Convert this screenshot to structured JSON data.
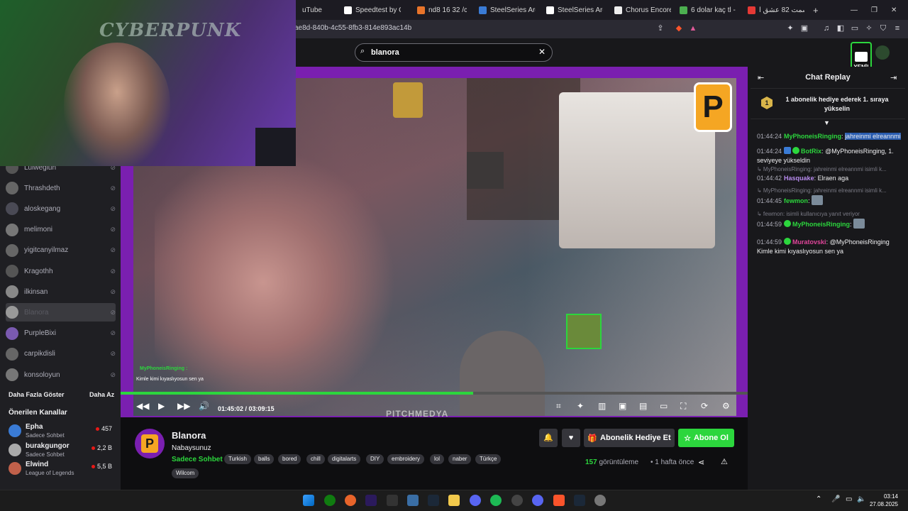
{
  "browser": {
    "tabs": [
      {
        "label": "uTube",
        "color": "#1c1b22"
      },
      {
        "label": "Speedtest by Ookla",
        "color": "#ffffff"
      },
      {
        "label": "nd8 16 32 /cpl fil",
        "color": "#e8742a"
      },
      {
        "label": "SteelSeries Arctis",
        "color": "#3a7bd5"
      },
      {
        "label": "SteelSeries Arctis",
        "color": "#ffffff"
      },
      {
        "label": "Chorus Encore",
        "color": "#eeeeee"
      },
      {
        "label": "6 dolar kaç tl - Go",
        "color": "#4caf50"
      },
      {
        "label": "قسمت 82 عشق ا",
        "color": "#e53935"
      }
    ],
    "new_tab": "+",
    "window_controls": [
      "—",
      "❐",
      "✕"
    ],
    "url": "ae8d-840b-4c55-8fb3-814e893ac14b"
  },
  "search": {
    "value": "blanora",
    "clear": "✕"
  },
  "header": {
    "new_badge": "YENİ!"
  },
  "webcam": {
    "overlay_text": "CYBERPUNK"
  },
  "sidebar": {
    "channels": [
      {
        "name": "Luiwegiun",
        "active": false
      },
      {
        "name": "Thrashdeth",
        "active": false
      },
      {
        "name": "aloskegang",
        "active": false
      },
      {
        "name": "melimoni",
        "active": false
      },
      {
        "name": "yigitcanyilmaz",
        "active": false
      },
      {
        "name": "Kragothh",
        "active": false
      },
      {
        "name": "ilkinsan",
        "active": false
      },
      {
        "name": "Blanora",
        "active": true
      },
      {
        "name": "PurpleBixi",
        "active": false
      },
      {
        "name": "carpikdisli",
        "active": false
      },
      {
        "name": "konsoloyun",
        "active": false
      }
    ],
    "more_label": "Daha Fazla Göster",
    "less_label": "Daha Az",
    "recommended_title": "Önerilen Kanallar",
    "recommended": [
      {
        "name": "Epha",
        "category": "Sadece Sohbet",
        "viewers": "457"
      },
      {
        "name": "burakgungor",
        "category": "Sadece Sohbet",
        "viewers": "2,2 B"
      },
      {
        "name": "Elwind",
        "category": "League of Legends",
        "viewers": "5,5 B"
      }
    ]
  },
  "player": {
    "logo": "P",
    "progress": 0.562,
    "current_time": "01:45:02",
    "duration": "03:09:15",
    "watermark": "PITCHMEDYA",
    "overlay_user": "MyPhoneisRinging :",
    "overlay_msg": "Kimle kimi kıyaslıyosun sen ya"
  },
  "channel": {
    "name": "Blanora",
    "title": "Nabaysunuz",
    "category": "Sadece Sohbet",
    "tags": [
      "Turkish",
      "balls",
      "bored",
      "chill",
      "digitalarts",
      "DIY",
      "embroidery",
      "lol",
      "naber",
      "Türkçe",
      "Wilcom"
    ],
    "gift_label": "Abonelik Hediye Et",
    "subscribe_label": "Abone Ol",
    "views_count": "157",
    "views_label": "görüntüleme",
    "ago": "1 hafta önce"
  },
  "chat": {
    "title": "Chat Replay",
    "banner_rank": "1",
    "banner_text": "1 abonelik hediye ederek 1. sıraya yükselin",
    "messages": [
      {
        "ts": "01:44:24",
        "user": "MyPhoneisRinging",
        "color": "#2cd63d",
        "text": "jahreinmi elreannmi",
        "reply": ""
      },
      {
        "ts": "01:44:24",
        "user": "BotRix",
        "color": "#2cd63d",
        "text": "@MyPhoneisRinging, 1. seviyeye yükseldin",
        "reply": ""
      },
      {
        "ts": "01:44:42",
        "user": "Hasquake",
        "color": "#b98cf0",
        "text": "Elraen aga",
        "reply": "MyPhoneisRinging: jahreinmi elreannmi isimli k..."
      },
      {
        "ts": "01:44:45",
        "user": "fewmon",
        "color": "#2cd63d",
        "text": "",
        "reply": "MyPhoneisRinging: jahreinmi elreannmi isimli k..."
      },
      {
        "ts": "01:44:59",
        "user": "MyPhoneisRinging",
        "color": "#2cd63d",
        "text": "",
        "reply": "fewmon: isimli kullanıcıya yanıt veriyor"
      },
      {
        "ts": "01:44:59",
        "user": "Muratovski",
        "color": "#e0459a",
        "text": "@MyPhoneisRinging Kimle kimi kıyaslıyosun sen ya",
        "reply": ""
      }
    ]
  },
  "taskbar": {
    "time": "03:14",
    "date": "27.08.2025"
  }
}
